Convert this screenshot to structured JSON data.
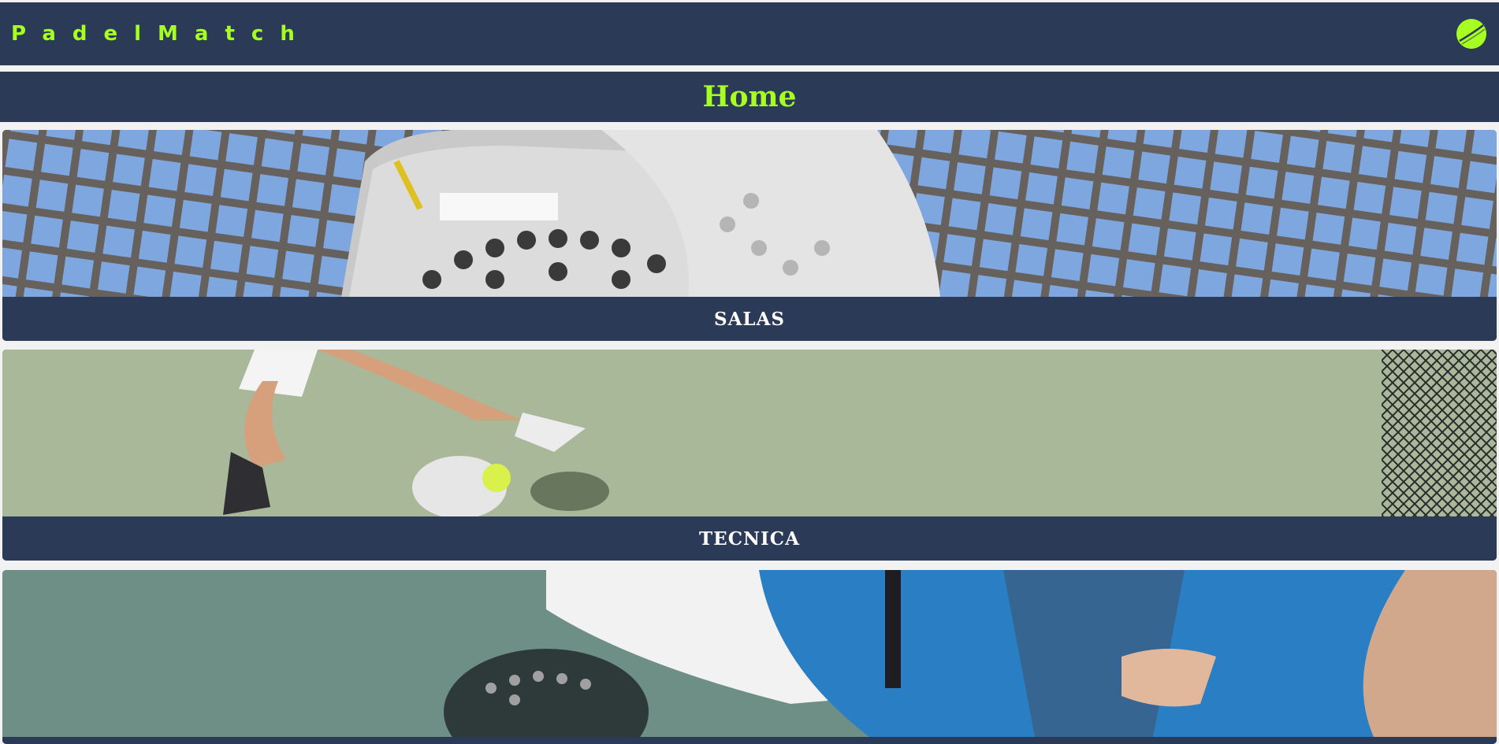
{
  "navbar": {
    "brand": "PadelMatch",
    "menu_icon": "tennis-ball-icon",
    "background": "#2b3a57",
    "accent": "#a6ff21"
  },
  "header": {
    "title": "Home"
  },
  "cards": [
    {
      "label": "SALAS",
      "image": "padel-rackets-net-photo"
    },
    {
      "label": "TECNICA",
      "image": "padel-player-court-photo"
    },
    {
      "label": "",
      "image": "padel-player-lying-photo"
    }
  ]
}
